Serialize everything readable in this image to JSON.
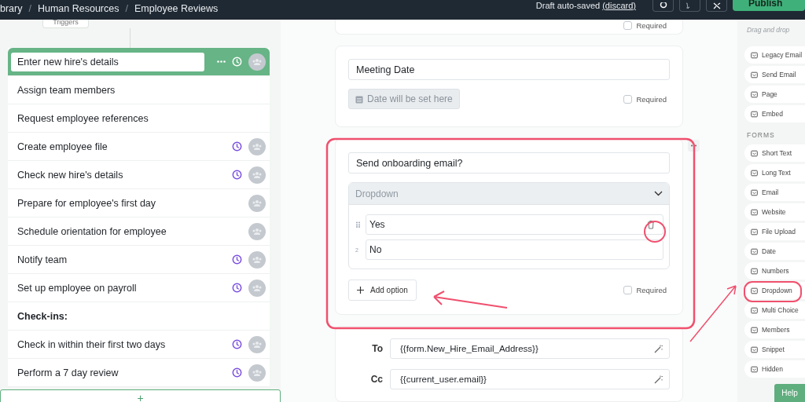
{
  "top_bar": {
    "breadcrumbs": [
      "brary",
      "Human Resources",
      "Employee Reviews"
    ],
    "breadcrumb_separator": "/",
    "save_status": "Draft auto-saved",
    "discard_link": "(discard)",
    "publish_button": "Publish"
  },
  "workflow": {
    "trigger_button": "Triggers",
    "tasks": [
      {
        "title": "Enter new hire's details",
        "kind": "task",
        "selected": true,
        "due_date": true,
        "assignee": true
      },
      {
        "title": "Assign team members",
        "kind": "task",
        "selected": false,
        "due_date": false,
        "assignee": false
      },
      {
        "title": "Request employee references",
        "kind": "task",
        "selected": false,
        "due_date": false,
        "assignee": false
      },
      {
        "title": "Create employee file",
        "kind": "task",
        "selected": false,
        "due_date": true,
        "assignee": true
      },
      {
        "title": "Check new hire's details",
        "kind": "task",
        "selected": false,
        "due_date": true,
        "assignee": true
      },
      {
        "title": "Prepare for employee's first day",
        "kind": "task",
        "selected": false,
        "due_date": false,
        "assignee": true
      },
      {
        "title": "Schedule orientation for employee",
        "kind": "task",
        "selected": false,
        "due_date": false,
        "assignee": true
      },
      {
        "title": "Notify team",
        "kind": "task",
        "selected": false,
        "due_date": true,
        "assignee": true
      },
      {
        "title": "Set up employee on payroll",
        "kind": "task",
        "selected": false,
        "due_date": true,
        "assignee": true
      },
      {
        "title": "Check-ins:",
        "kind": "heading",
        "selected": false,
        "due_date": false,
        "assignee": false
      },
      {
        "title": "Check in within their first two days",
        "kind": "task",
        "selected": false,
        "due_date": true,
        "assignee": true
      },
      {
        "title": "Perform a 7 day review",
        "kind": "task",
        "selected": false,
        "due_date": true,
        "assignee": true
      }
    ],
    "add_button": "+"
  },
  "form": {
    "cards": [
      {
        "kind": "tail",
        "required_label": "Required",
        "required": false
      },
      {
        "kind": "date",
        "label": "Meeting Date",
        "placeholder": "Date will be set here",
        "required_label": "Required",
        "required": false
      },
      {
        "kind": "dropdown",
        "label": "Send onboarding email?",
        "placeholder": "Dropdown",
        "options": [
          {
            "value": "Yes",
            "hovered": true
          },
          {
            "number": "2",
            "value": "No",
            "hovered": false
          }
        ],
        "add_option": "Add option",
        "required_label": "Required",
        "required": false
      },
      {
        "kind": "email",
        "fields": [
          {
            "label": "To",
            "value": "{{form.New_Hire_Email_Address}}"
          },
          {
            "label": "Cc",
            "value": "{{current_user.email}}"
          }
        ]
      }
    ]
  },
  "sidebar": {
    "hint": "Drag and drop",
    "items": [
      "Legacy Email",
      "Send Email",
      "Page",
      "Embed"
    ],
    "section": "FORMS",
    "form_items": [
      "Short Text",
      "Long Text",
      "Email",
      "Website",
      "File Upload",
      "Date",
      "Numbers",
      "Dropdown",
      "Multi Choice",
      "Members",
      "Snippet",
      "Hidden"
    ],
    "help_button": "Help"
  }
}
